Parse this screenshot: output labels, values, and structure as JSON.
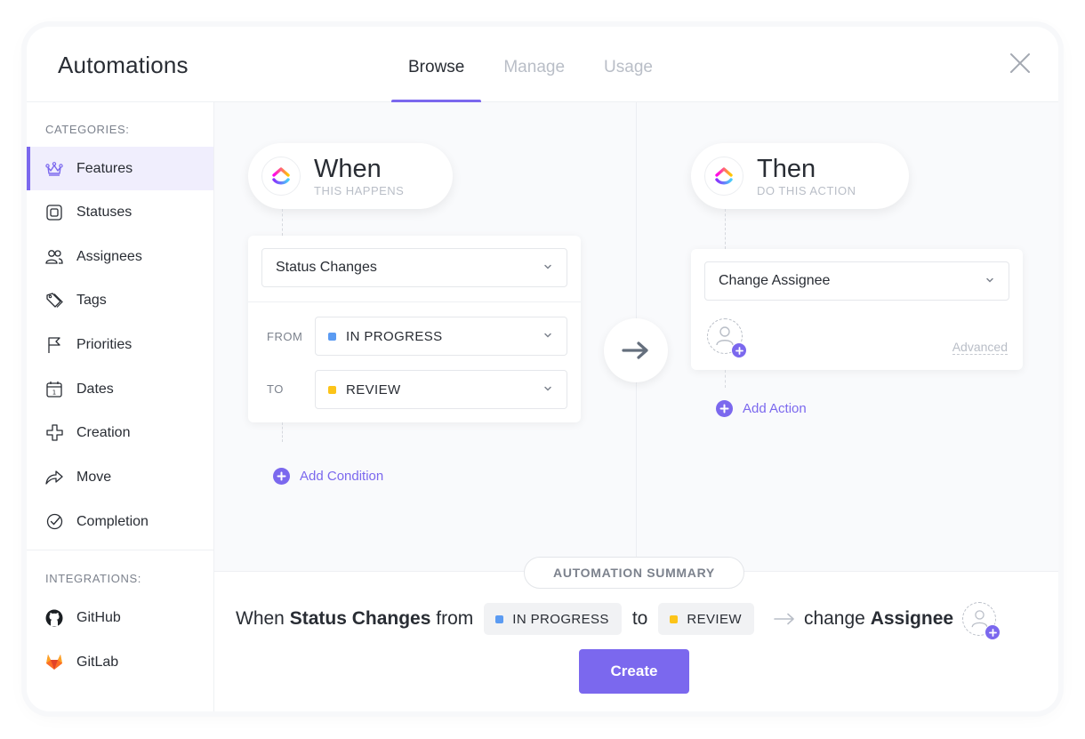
{
  "header": {
    "title": "Automations",
    "tabs": [
      {
        "label": "Browse",
        "active": true
      },
      {
        "label": "Manage",
        "active": false
      },
      {
        "label": "Usage",
        "active": false
      }
    ]
  },
  "sidebar": {
    "categories_label": "CATEGORIES:",
    "categories": [
      {
        "label": "Features",
        "icon": "crown-icon",
        "active": true
      },
      {
        "label": "Statuses",
        "icon": "status-square-icon"
      },
      {
        "label": "Assignees",
        "icon": "users-icon"
      },
      {
        "label": "Tags",
        "icon": "tag-icon"
      },
      {
        "label": "Priorities",
        "icon": "flag-icon"
      },
      {
        "label": "Dates",
        "icon": "calendar-icon"
      },
      {
        "label": "Creation",
        "icon": "plus-outline-icon"
      },
      {
        "label": "Move",
        "icon": "share-arrow-icon"
      },
      {
        "label": "Completion",
        "icon": "check-circle-icon"
      }
    ],
    "integrations_label": "INTEGRATIONS:",
    "integrations": [
      {
        "label": "GitHub",
        "icon": "github-icon"
      },
      {
        "label": "GitLab",
        "icon": "gitlab-icon"
      }
    ]
  },
  "trigger": {
    "title": "When",
    "subtitle": "THIS HAPPENS",
    "event": "Status Changes",
    "from_label": "FROM",
    "from_value": "IN PROGRESS",
    "from_color": "#5b9bf2",
    "to_label": "TO",
    "to_value": "REVIEW",
    "to_color": "#fcc419",
    "add_condition": "Add Condition"
  },
  "action": {
    "title": "Then",
    "subtitle": "DO THIS ACTION",
    "event": "Change Assignee",
    "advanced": "Advanced",
    "add_action": "Add Action"
  },
  "summary": {
    "tag": "AUTOMATION SUMMARY",
    "when": "When",
    "trigger": "Status Changes",
    "from": "from",
    "from_status": "IN PROGRESS",
    "to": "to",
    "to_status": "REVIEW",
    "change": "change",
    "target": "Assignee"
  },
  "create_button": "Create",
  "colors": {
    "accent": "#7b68ee",
    "in_progress": "#5b9bf2",
    "review": "#fcc419"
  }
}
